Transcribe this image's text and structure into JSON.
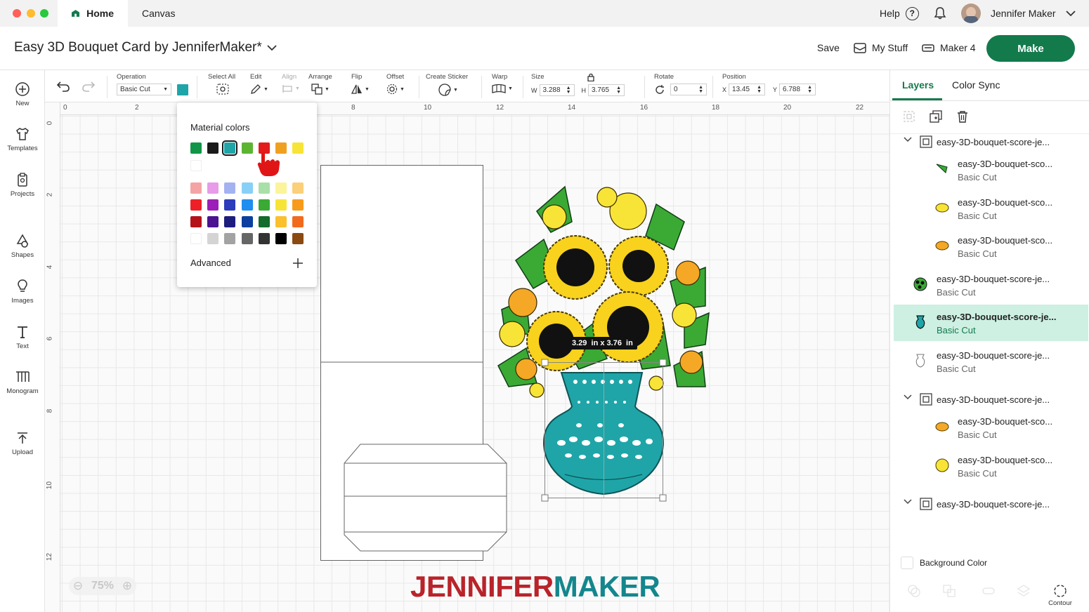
{
  "titlebar": {
    "tabs": [
      "Home",
      "Canvas"
    ],
    "help": "Help",
    "help_icon": "question-mark",
    "user_name": "Jennifer Maker"
  },
  "header": {
    "project_title": "Easy 3D Bouquet Card by JenniferMaker*",
    "save": "Save",
    "my_stuff": "My Stuff",
    "machine": "Maker 4",
    "make": "Make"
  },
  "sidebar": [
    {
      "label": "New",
      "icon": "plus-circle-icon"
    },
    {
      "label": "Templates",
      "icon": "shirt-icon"
    },
    {
      "label": "Projects",
      "icon": "clipboard-icon"
    },
    {
      "label": "Shapes",
      "icon": "shapes-icon"
    },
    {
      "label": "Images",
      "icon": "bulb-icon"
    },
    {
      "label": "Text",
      "icon": "text-icon"
    },
    {
      "label": "Monogram",
      "icon": "monogram-icon"
    },
    {
      "label": "Upload",
      "icon": "upload-icon"
    }
  ],
  "toolbar": {
    "operation_label": "Operation",
    "operation_value": "Basic Cut",
    "operation_color": "#1fa5a8",
    "select_all": "Select All",
    "edit": "Edit",
    "align": "Align",
    "arrange": "Arrange",
    "flip": "Flip",
    "offset": "Offset",
    "create_sticker": "Create Sticker",
    "warp": "Warp",
    "size_label": "Size",
    "w_label": "W",
    "w_value": "3.288",
    "h_label": "H",
    "h_value": "3.765",
    "rotate_label": "Rotate",
    "rotate_value": "0",
    "position_label": "Position",
    "x_label": "X",
    "x_value": "13.45",
    "y_label": "Y",
    "y_value": "6.788"
  },
  "ruler": {
    "top": [
      "0",
      "2",
      "8",
      "10",
      "12",
      "14",
      "16",
      "18",
      "20",
      "22"
    ],
    "left": [
      "0",
      "2",
      "4",
      "6",
      "8",
      "10",
      "12"
    ]
  },
  "popup": {
    "title": "Material colors",
    "advanced": "Advanced",
    "recent": [
      "#109646",
      "#1a1a1a",
      "#1fa5a8",
      "#5cb531",
      "#e31b1b",
      "#f0a020",
      "#f8e436"
    ],
    "palette": [
      [
        "#f4a4a4",
        "#e79be8",
        "#a3b3f2",
        "#89d0f8",
        "#a8e0a8",
        "#fbf49a",
        "#fbd07a"
      ],
      [
        "#ee2027",
        "#9b1fb8",
        "#2d3cbd",
        "#1e8ef0",
        "#3aaa35",
        "#f8e436",
        "#f89b1c"
      ],
      [
        "#b41218",
        "#4b1390",
        "#1d1d7e",
        "#0b3fa0",
        "#136b2c",
        "#fbc02d",
        "#f26b1d"
      ],
      [
        "#ffffff",
        "#d4d4d4",
        "#a3a3a3",
        "#666666",
        "#333333",
        "#000000",
        "#8b4a12"
      ]
    ]
  },
  "canvas": {
    "size_tooltip": "3.29  in x 3.76  in",
    "zoom": "75%"
  },
  "logo": {
    "part1": "JENNIFER",
    "part2": "MAKER"
  },
  "rpanel": {
    "tabs": [
      "Layers",
      "Color Sync"
    ],
    "layers": [
      {
        "type": "group",
        "name": "easy-3D-bouquet-score-je..."
      },
      {
        "type": "item",
        "name": "easy-3D-bouquet-sco...",
        "op": "Basic Cut",
        "icon": "leaf-green"
      },
      {
        "type": "item",
        "name": "easy-3D-bouquet-sco...",
        "op": "Basic Cut",
        "icon": "petal-yellow"
      },
      {
        "type": "item",
        "name": "easy-3D-bouquet-sco...",
        "op": "Basic Cut",
        "icon": "petal-orange"
      },
      {
        "type": "item",
        "name": "easy-3D-bouquet-score-je...",
        "op": "Basic Cut",
        "icon": "flowers-dark"
      },
      {
        "type": "item",
        "name": "easy-3D-bouquet-score-je...",
        "op": "Basic Cut",
        "icon": "vase-teal",
        "selected": true
      },
      {
        "type": "item",
        "name": "easy-3D-bouquet-score-je...",
        "op": "Basic Cut",
        "icon": "vase-outline"
      },
      {
        "type": "group",
        "name": "easy-3D-bouquet-score-je..."
      },
      {
        "type": "item",
        "name": "easy-3D-bouquet-sco...",
        "op": "Basic Cut",
        "icon": "petal-orange"
      },
      {
        "type": "item",
        "name": "easy-3D-bouquet-sco...",
        "op": "Basic Cut",
        "icon": "circle-yellow"
      },
      {
        "type": "group",
        "name": "easy-3D-bouquet-score-je..."
      }
    ],
    "background_color": "Background Color",
    "contour": "Contour"
  }
}
